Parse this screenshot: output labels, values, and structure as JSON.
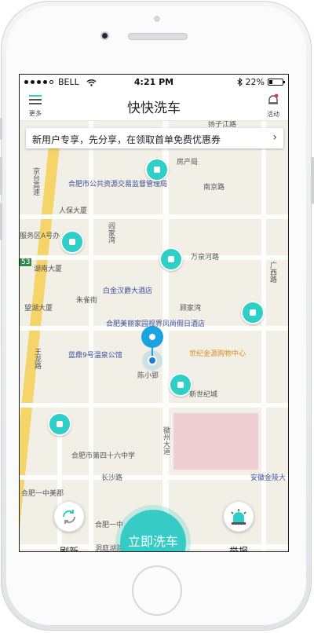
{
  "status": {
    "carrier": "BELL",
    "time": "4:21 PM",
    "battery": "22%"
  },
  "nav": {
    "title": "快快洗车",
    "menu_label": "更多",
    "notify_label": "活动"
  },
  "promo": {
    "text": "新用户专享，先分享，在领取首单免费优惠券",
    "chevron": "›"
  },
  "map_labels": [
    "扬子江路",
    "房产局",
    "合肥市公共资源交易监督管理局",
    "南京路",
    "京台高速",
    "人保大厦",
    "服务区A号办",
    "湖南大厦",
    "万泉河路",
    "白金汉爵大酒店",
    "朱雀街",
    "望湖大厦",
    "顾家湾",
    "合肥美丽家园视界风尚假日酒店",
    "蓝鼎9号温泉公馆",
    "世纪金源购物中心",
    "陈小郢",
    "新世纪城",
    "王龙路",
    "合肥市第四十六中学",
    "长沙路",
    "合肥一中美郡",
    "合肥一中",
    "安徽金陵大",
    "洞庭湖路",
    "徽州大道",
    "阎家湾",
    "广西路",
    "53"
  ],
  "actions": {
    "refresh_label": "刷新",
    "wash_label": "立即洗车",
    "report_label": "举报"
  },
  "colors": {
    "accent": "#36cbc4",
    "location": "#1aa3e0"
  }
}
